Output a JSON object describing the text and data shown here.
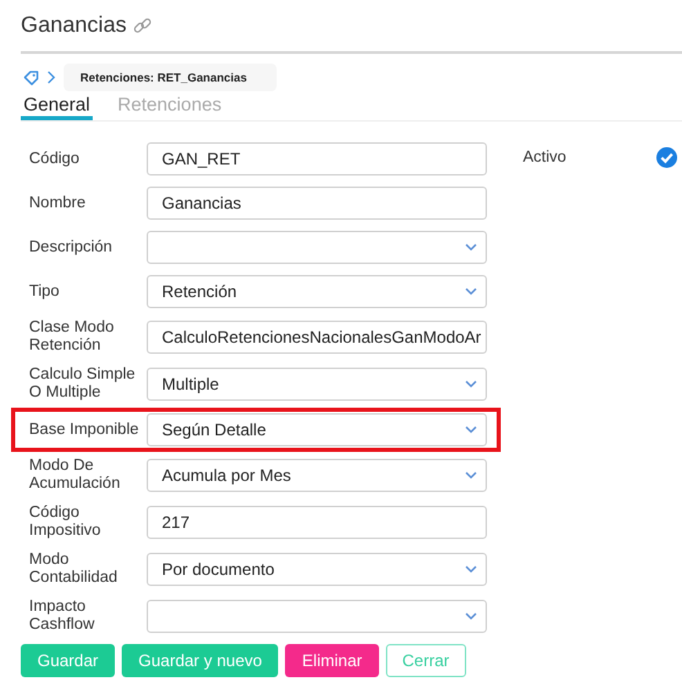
{
  "header": {
    "title": "Ganancias"
  },
  "breadcrumb": {
    "items": [
      "Retenciones: RET_Ganancias"
    ]
  },
  "tabs": [
    {
      "label": "General",
      "selected": true
    },
    {
      "label": "Retenciones",
      "selected": false
    }
  ],
  "fields": [
    {
      "label": "Código",
      "kind": "text",
      "value": "GAN_RET",
      "highlighted": false
    },
    {
      "label": "Nombre",
      "kind": "text",
      "value": "Ganancias",
      "highlighted": false
    },
    {
      "label": "Descripción",
      "kind": "select",
      "highlighted": false
    },
    {
      "label": "Tipo",
      "kind": "select",
      "value": "Retención",
      "highlighted": false
    },
    {
      "label": "Clase Modo Retención",
      "kind": "text",
      "value": "CalculoRetencionesNacionalesGanModoAr",
      "highlighted": false
    },
    {
      "label": "Calculo Simple O Multiple",
      "kind": "select",
      "value": "Multiple",
      "highlighted": false
    },
    {
      "label": "Base Imponible",
      "kind": "select",
      "value": "Según Detalle",
      "highlighted": true
    },
    {
      "label": "Modo De Acumulación",
      "kind": "select",
      "value": "Acumula por Mes",
      "highlighted": false
    },
    {
      "label": "Código Impositivo",
      "kind": "text",
      "value": "217",
      "highlighted": false
    },
    {
      "label": "Modo Contabilidad",
      "kind": "select",
      "value": "Por documento",
      "highlighted": false
    },
    {
      "label": "Impacto Cashflow",
      "kind": "select",
      "highlighted": false
    }
  ],
  "active": {
    "label": "Activo",
    "checked": true
  },
  "buttons": [
    {
      "label": "Guardar",
      "kind": "primary"
    },
    {
      "label": "Guardar y nuevo",
      "kind": "primary"
    },
    {
      "label": "Eliminar",
      "kind": "danger"
    },
    {
      "label": "Cerrar",
      "kind": "outline"
    }
  ]
}
